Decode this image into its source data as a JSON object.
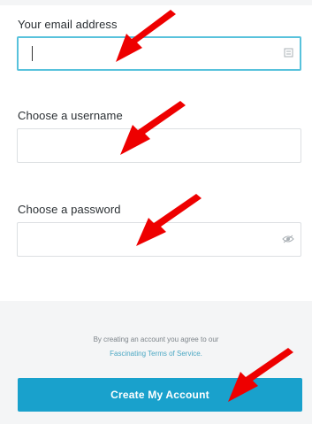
{
  "signup_form": {
    "email": {
      "label": "Your email address",
      "value": "",
      "placeholder": ""
    },
    "username": {
      "label": "Choose a username",
      "value": "",
      "placeholder": ""
    },
    "password": {
      "label": "Choose a password",
      "value": "",
      "placeholder": ""
    },
    "terms_prefix": "By creating an account you agree to our",
    "terms_link": "Fascinating Terms of Service.",
    "submit_label": "Create My Account"
  },
  "icons": {
    "email_field_icon": "card-icon",
    "password_field_icon": "eye-icon",
    "annotation_arrow": "red-arrow-icon"
  },
  "colors": {
    "accent": "#19a1cc",
    "focus_border": "#58c2dc",
    "arrow": "#ee0000",
    "footer_bg": "#f4f5f6"
  }
}
